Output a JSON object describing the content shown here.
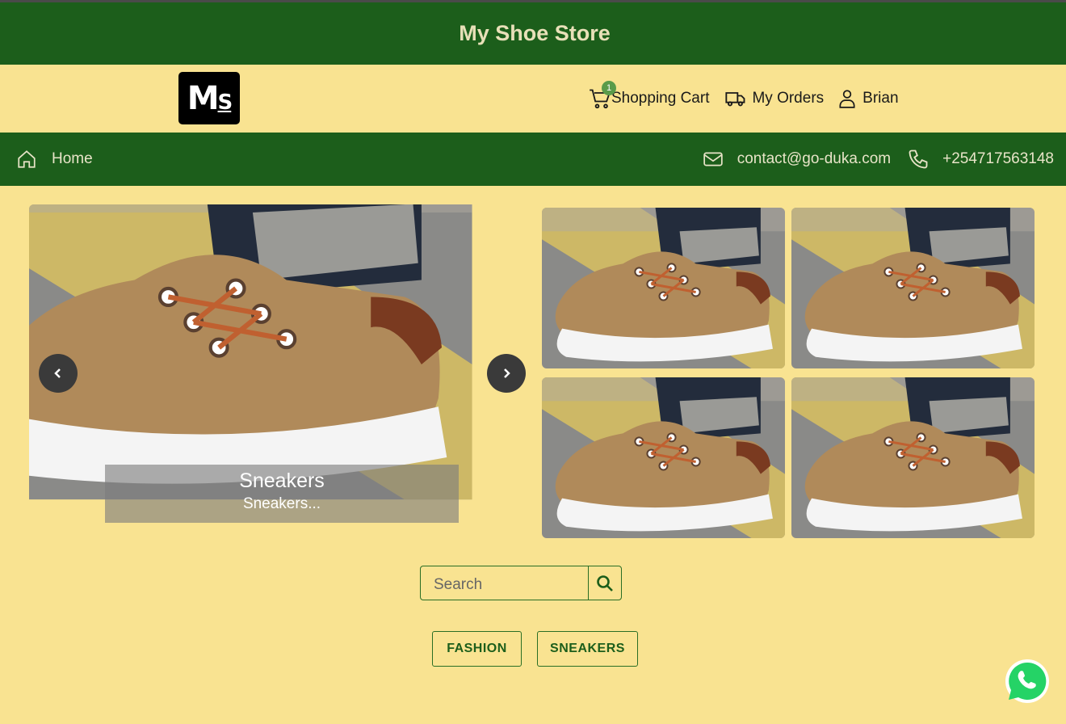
{
  "store_title": "My Shoe Store",
  "logo_text": "MS",
  "header_nav": {
    "cart_label": "Shopping Cart",
    "cart_count": "1",
    "orders_label": "My Orders",
    "user_label": "Brian"
  },
  "navbar": {
    "home_label": "Home",
    "email": "contact@go-duka.com",
    "phone": "+254717563148"
  },
  "carousel": {
    "caption_title": "Sneakers",
    "caption_subtitle": "Sneakers..."
  },
  "search": {
    "placeholder": "Search"
  },
  "categories": [
    "FASHION",
    "SNEAKERS"
  ],
  "colors": {
    "primary_green": "#1c5e1b",
    "background": "#f9e391"
  }
}
